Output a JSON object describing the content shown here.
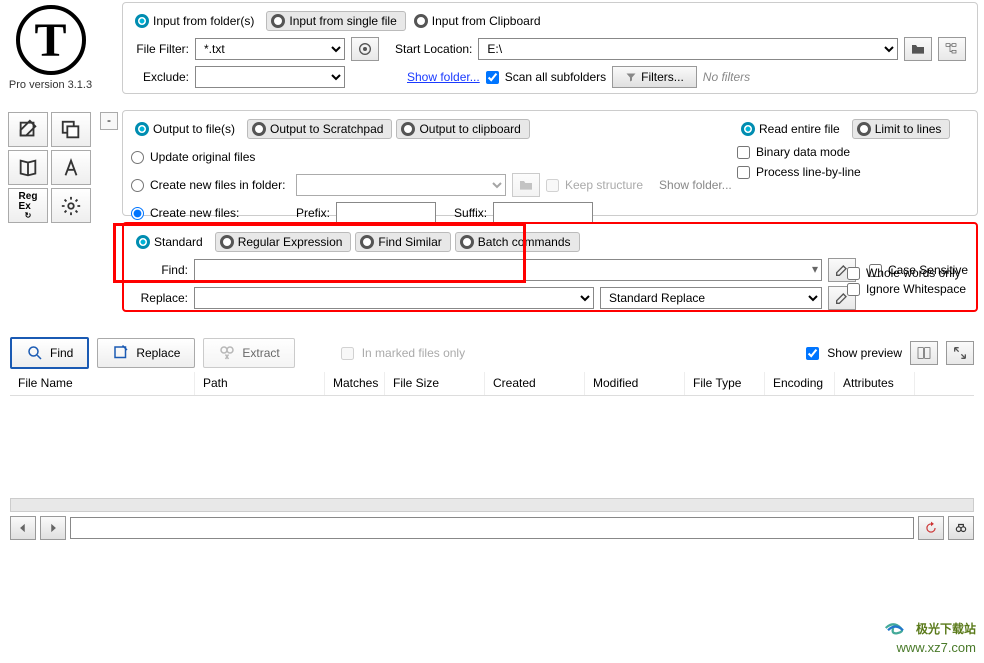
{
  "app": {
    "logo_letter": "T",
    "version": "Pro version 3.1.3"
  },
  "input": {
    "modes": {
      "folders": "Input from folder(s)",
      "single": "Input from single file",
      "clipboard": "Input from Clipboard"
    },
    "file_filter_label": "File Filter:",
    "file_filter_value": "*.txt",
    "start_location_label": "Start Location:",
    "start_location_value": "E:\\",
    "exclude_label": "Exclude:",
    "show_folder_link": "Show folder...",
    "scan_subfolders": "Scan all subfolders",
    "filters_btn": "Filters...",
    "no_filters": "No filters"
  },
  "output": {
    "modes": {
      "files": "Output to file(s)",
      "scratchpad": "Output to Scratchpad",
      "clipboard": "Output to clipboard"
    },
    "update_original": "Update original files",
    "create_in_folder": "Create new files in folder:",
    "keep_structure": "Keep structure",
    "show_folder": "Show folder...",
    "create_new": "Create new files:",
    "prefix_label": "Prefix:",
    "suffix_label": "Suffix:",
    "read_entire": "Read entire file",
    "limit_lines": "Limit to lines",
    "binary_mode": "Binary data mode",
    "process_line": "Process line-by-line"
  },
  "search": {
    "modes": {
      "standard": "Standard",
      "regex": "Regular Expression",
      "similar": "Find Similar",
      "batch": "Batch commands"
    },
    "find_label": "Find:",
    "replace_label": "Replace:",
    "replace_mode": "Standard Replace",
    "case_sensitive": "Case Sensitive",
    "whole_words": "Whole words only",
    "ignore_ws": "Ignore Whitespace"
  },
  "actions": {
    "find": "Find",
    "replace": "Replace",
    "extract": "Extract",
    "marked_only": "In marked files only",
    "show_preview": "Show preview"
  },
  "table": {
    "cols": {
      "filename": "File Name",
      "path": "Path",
      "matches": "Matches",
      "filesize": "File Size",
      "created": "Created",
      "modified": "Modified",
      "filetype": "File Type",
      "encoding": "Encoding",
      "attributes": "Attributes"
    }
  },
  "watermark": {
    "main": "极光下载站",
    "sub": "www.xz7.com"
  }
}
